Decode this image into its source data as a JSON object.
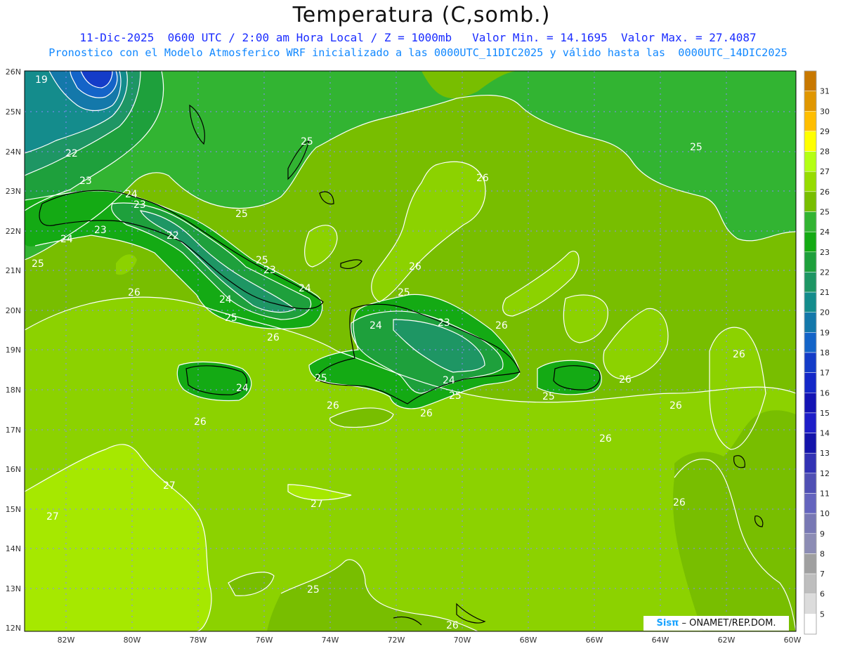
{
  "title": "Temperatura (C,somb.)",
  "subtitle_line1": "11-Dic-2025  0600 UTC / 2:00 am Hora Local / Z = 1000mb   Valor Min. = 14.1695  Valor Max. = 27.4087",
  "subtitle_line2": "Pronostico con el Modelo Atmosferico WRF inicializado a las 0000UTC_11DIC2025 y válido hasta las  0000UTC_14DIC2025",
  "credit": {
    "logo": "Sisπ",
    "text": " – ONAMET/REP.DOM."
  },
  "lat_labels": [
    "26N",
    "25N",
    "24N",
    "23N",
    "22N",
    "21N",
    "20N",
    "19N",
    "18N",
    "17N",
    "16N",
    "15N",
    "14N",
    "13N",
    "12N"
  ],
  "lon_labels": [
    "82W",
    "80W",
    "78W",
    "76W",
    "74W",
    "72W",
    "70W",
    "68W",
    "66W",
    "64W",
    "62W",
    "60W"
  ],
  "colorbar": {
    "labels": [
      "31",
      "30",
      "29",
      "28",
      "27",
      "26",
      "25",
      "24",
      "23",
      "22",
      "21",
      "20",
      "19",
      "18",
      "17",
      "16",
      "15",
      "14",
      "13",
      "12",
      "11",
      "10",
      "9",
      "8",
      "7",
      "6",
      "5"
    ],
    "colors": [
      "#c87800",
      "#e09600",
      "#ffbe00",
      "#ffff00",
      "#b4ff14",
      "#96dc00",
      "#78be00",
      "#32b432",
      "#14aa14",
      "#1ea03c",
      "#1e9664",
      "#148c8c",
      "#1478aa",
      "#1464c8",
      "#143cc8",
      "#1428c8",
      "#1414b4",
      "#1e1ec8",
      "#1414aa",
      "#3232b4",
      "#5050b4",
      "#6464be",
      "#7878b4",
      "#8c8cb4",
      "#a0a0a0",
      "#bebebe",
      "#dcdcdc",
      "#ffffff"
    ]
  },
  "contour_labels": [
    "19",
    "22",
    "23",
    "24",
    "23",
    "23",
    "22",
    "24",
    "25",
    "25",
    "25",
    "26",
    "25",
    "23",
    "24",
    "24",
    "25",
    "26",
    "26",
    "25",
    "26",
    "23",
    "24",
    "24",
    "25",
    "25",
    "24",
    "25",
    "26",
    "26",
    "25",
    "26",
    "26",
    "27",
    "27",
    "27",
    "26",
    "26",
    "26",
    "26",
    "25",
    "26",
    "26"
  ]
}
